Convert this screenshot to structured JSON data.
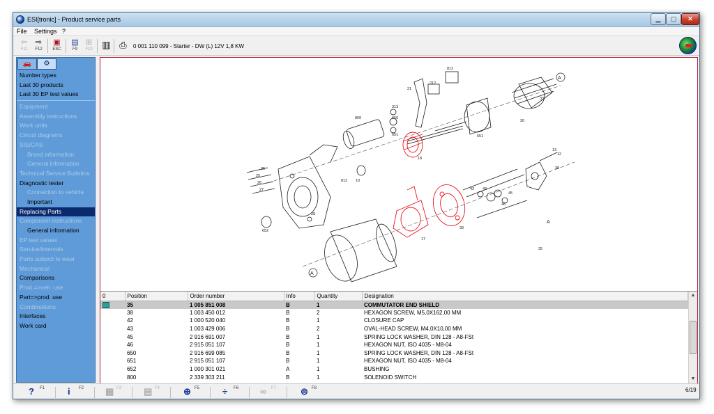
{
  "window": {
    "title": "ESI[tronic] - Product service parts",
    "min_label": "▁",
    "max_label": "▢",
    "close_label": "✕"
  },
  "menu": {
    "items": [
      "File",
      "Settings",
      "?"
    ]
  },
  "toolbar": {
    "buttons": [
      {
        "icon": "back-arrow-icon",
        "glyph": "⇦",
        "key": "F11",
        "enabled": false
      },
      {
        "icon": "forward-arrow-icon",
        "glyph": "⇨",
        "key": "F12",
        "enabled": true
      },
      {
        "icon": "exit-icon",
        "glyph": "▣",
        "key": "ESC",
        "enabled": true
      },
      {
        "icon": "document-list-icon",
        "glyph": "▤",
        "key": "F9",
        "enabled": true
      },
      {
        "icon": "tree-icon",
        "glyph": "⊞",
        "key": "F10",
        "enabled": false
      },
      {
        "icon": "document-icon",
        "glyph": "▥",
        "key": "",
        "enabled": true
      },
      {
        "icon": "printer-icon",
        "glyph": "⎙",
        "key": "",
        "enabled": true
      }
    ],
    "product_title": "0 001 110 099 - Starter - DW (L) 12V 1,8 KW"
  },
  "sidebar": {
    "tabs": [
      {
        "icon": "vehicle-icon",
        "glyph": "🚗"
      },
      {
        "icon": "component-icon",
        "glyph": "⚙"
      }
    ],
    "items_top": [
      {
        "label": "Number types",
        "dim": false,
        "sub": false,
        "selected": false
      },
      {
        "label": "Last 30 products",
        "dim": false,
        "sub": false,
        "selected": false
      },
      {
        "label": "Last 30 EP test values",
        "dim": false,
        "sub": false,
        "selected": false
      }
    ],
    "items": [
      {
        "label": "Equipment",
        "dim": true,
        "sub": false,
        "selected": false
      },
      {
        "label": "Assembly instructions",
        "dim": true,
        "sub": false,
        "selected": false
      },
      {
        "label": "Work units",
        "dim": true,
        "sub": false,
        "selected": false
      },
      {
        "label": "Circuit diagrams",
        "dim": true,
        "sub": false,
        "selected": false
      },
      {
        "label": "SIS/CAS",
        "dim": true,
        "sub": false,
        "selected": false
      },
      {
        "label": "Brand information",
        "dim": true,
        "sub": true,
        "selected": false
      },
      {
        "label": "General information",
        "dim": true,
        "sub": true,
        "selected": false
      },
      {
        "label": "Technical Service Bulletins",
        "dim": true,
        "sub": false,
        "selected": false
      },
      {
        "label": "Diagnostic tester",
        "dim": false,
        "sub": false,
        "selected": false
      },
      {
        "label": "Connection to vehicle",
        "dim": true,
        "sub": true,
        "selected": false
      },
      {
        "label": "Important",
        "dim": false,
        "sub": true,
        "selected": false
      },
      {
        "label": "Replacing Parts",
        "dim": false,
        "sub": false,
        "selected": true
      },
      {
        "label": "Component instructions",
        "dim": true,
        "sub": false,
        "selected": false
      },
      {
        "label": "General information",
        "dim": false,
        "sub": true,
        "selected": false
      },
      {
        "label": "EP test values",
        "dim": true,
        "sub": false,
        "selected": false
      },
      {
        "label": "Service/Intervals",
        "dim": true,
        "sub": false,
        "selected": false
      },
      {
        "label": "Parts subject to wear",
        "dim": true,
        "sub": false,
        "selected": false
      },
      {
        "label": "Mechanical",
        "dim": true,
        "sub": false,
        "selected": false
      },
      {
        "label": "Comparisons",
        "dim": false,
        "sub": false,
        "selected": false
      },
      {
        "label": "Prod.=>veh. use",
        "dim": true,
        "sub": false,
        "selected": false
      },
      {
        "label": "Part=>prod. use",
        "dim": false,
        "sub": false,
        "selected": false
      },
      {
        "label": "Combinations",
        "dim": true,
        "sub": false,
        "selected": false
      },
      {
        "label": "Interfaces",
        "dim": false,
        "sub": false,
        "selected": false
      },
      {
        "label": "Work card",
        "dim": false,
        "sub": false,
        "selected": false
      }
    ]
  },
  "drawing": {
    "labels": [
      "A",
      "A",
      "A",
      "33",
      "30",
      "25",
      "26",
      "27",
      "28",
      "652",
      "25",
      "800",
      "21",
      "212",
      "812",
      "313",
      "650",
      "651",
      "10",
      "18",
      "35",
      "46",
      "45",
      "42",
      "38",
      "43",
      "12",
      "13",
      "39",
      "812",
      "651",
      "17"
    ],
    "highlight_color": "#e8141e",
    "line_color": "#1a1a1a"
  },
  "table": {
    "columns": [
      "0",
      "Position",
      "Order number",
      "Info",
      "Quantity",
      "Designation"
    ],
    "rows": [
      {
        "position": "35",
        "order": "1 005 851 008",
        "info": "B",
        "qty": "1",
        "designation": "COMMUTATOR END SHIELD",
        "highlight": true
      },
      {
        "position": "38",
        "order": "1 003 450 012",
        "info": "B",
        "qty": "2",
        "designation": "HEXAGON SCREW,   M5,0X162,00 MM",
        "highlight": false
      },
      {
        "position": "42",
        "order": "1 000 520 040",
        "info": "B",
        "qty": "1",
        "designation": "CLOSURE CAP",
        "highlight": false
      },
      {
        "position": "43",
        "order": "1 003 429 006",
        "info": "B",
        "qty": "2",
        "designation": "OVAL-HEAD SCREW,   M4,0X10,00 MM",
        "highlight": false
      },
      {
        "position": "45",
        "order": "2 916 691 007",
        "info": "B",
        "qty": "1",
        "designation": "SPRING LOCK WASHER,   DIN 128 - A8-FSt",
        "highlight": false
      },
      {
        "position": "46",
        "order": "2 915 051 107",
        "info": "B",
        "qty": "1",
        "designation": "HEXAGON NUT,   ISO 4035 - M8-04",
        "highlight": false
      },
      {
        "position": "650",
        "order": "2 916 699 085",
        "info": "B",
        "qty": "1",
        "designation": "SPRING LOCK WASHER,   DIN 128 - A8-FSt",
        "highlight": false
      },
      {
        "position": "651",
        "order": "2 915 051 107",
        "info": "B",
        "qty": "1",
        "designation": "HEXAGON NUT,   ISO 4035 - M8-04",
        "highlight": false
      },
      {
        "position": "652",
        "order": "1 000 301 021",
        "info": "A",
        "qty": "1",
        "designation": "BUSHING",
        "highlight": false
      },
      {
        "position": "800",
        "order": "2 339 303 211",
        "info": "B",
        "qty": "1",
        "designation": "SOLENOID SWITCH",
        "highlight": false
      }
    ],
    "scroll_up": "▲",
    "scroll_down": "▼"
  },
  "statusbar": {
    "buttons": [
      {
        "icon": "help-icon",
        "glyph": "?",
        "key": "F1",
        "enabled": true
      },
      {
        "icon": "info-icon",
        "glyph": "i",
        "key": "F2",
        "enabled": true
      },
      {
        "icon": "calculator-icon",
        "glyph": "▦",
        "key": "F3",
        "enabled": false
      },
      {
        "icon": "compare-icon",
        "glyph": "▤",
        "key": "F4",
        "enabled": false
      },
      {
        "icon": "zoom-icon",
        "glyph": "⊕",
        "key": "F5",
        "enabled": true
      },
      {
        "icon": "split-icon",
        "glyph": "÷",
        "key": "F6",
        "enabled": true
      },
      {
        "icon": "chain-icon",
        "glyph": "∞",
        "key": "F7",
        "enabled": false
      },
      {
        "icon": "bosch-icon",
        "glyph": "⊜",
        "key": "F8",
        "enabled": true
      }
    ],
    "page_count": "6/19"
  }
}
